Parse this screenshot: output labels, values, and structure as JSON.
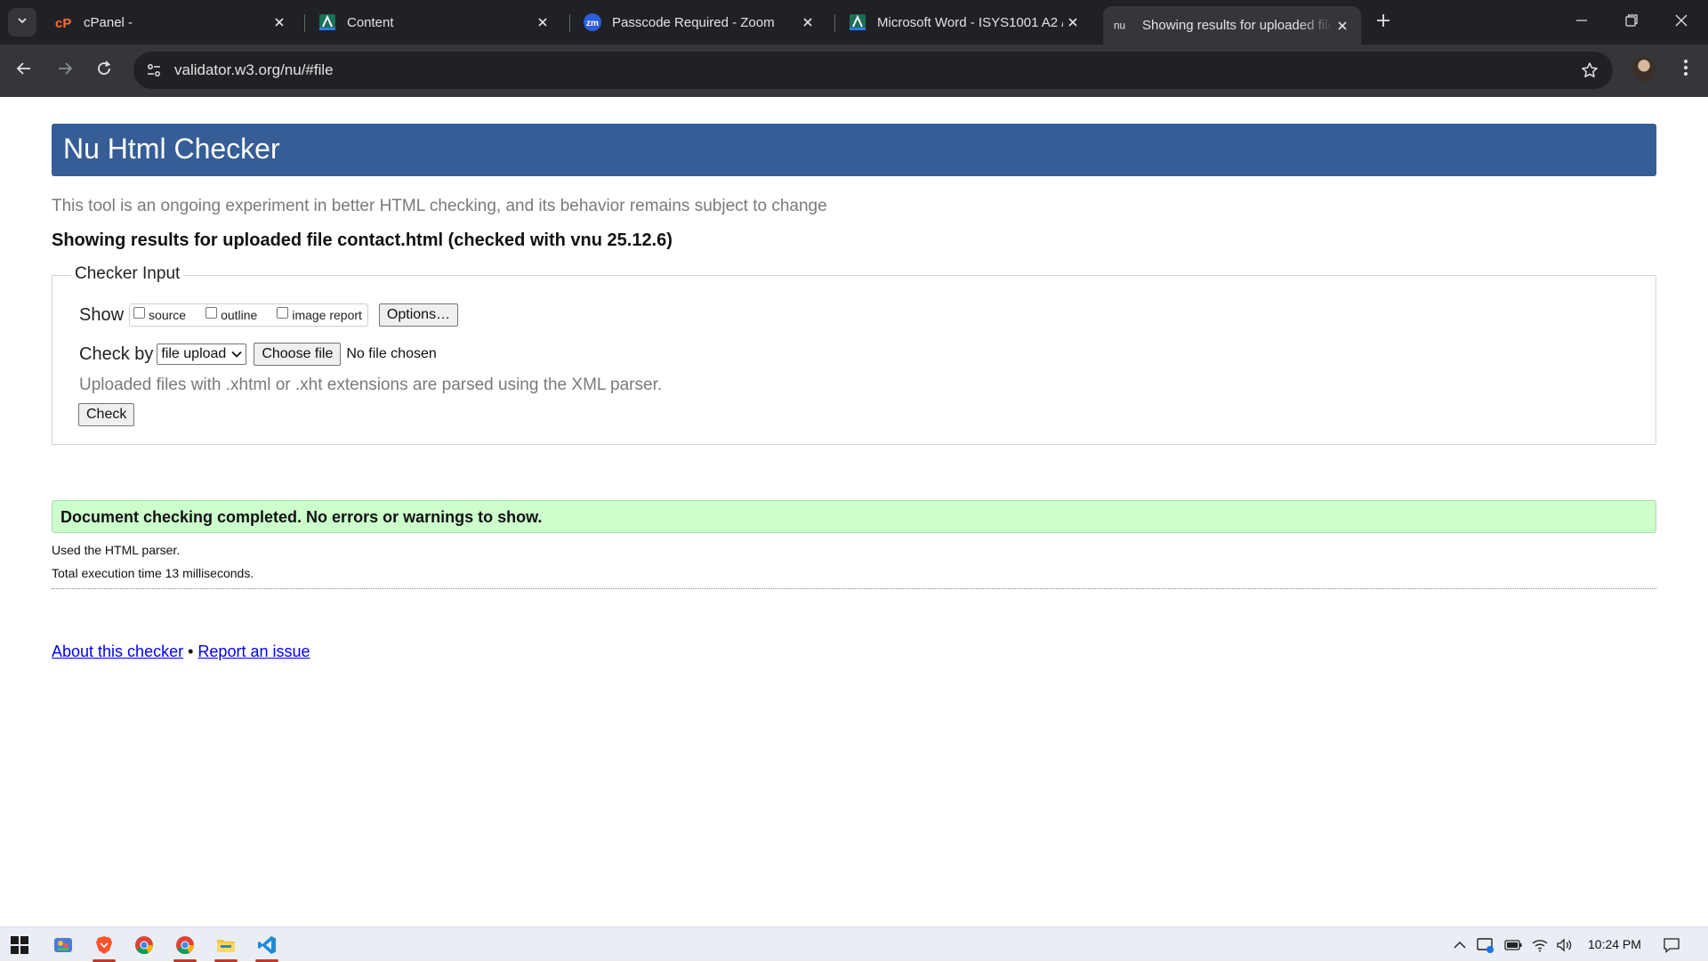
{
  "browser": {
    "tabs": [
      {
        "title": "cPanel -",
        "favicon": "cpanel-icon",
        "active": false
      },
      {
        "title": "Content",
        "favicon": "a-logo-icon",
        "active": false
      },
      {
        "title": "Passcode Required - Zoom",
        "favicon": "zoom-icon",
        "active": false
      },
      {
        "title": "Microsoft Word - ISYS1001 A2 /",
        "favicon": "a-logo-icon",
        "active": false
      },
      {
        "title": "Showing results for uploaded file",
        "favicon": "nu-icon",
        "active": true
      }
    ],
    "url": "validator.w3.org/nu/#file"
  },
  "page": {
    "banner_title": "Nu Html Checker",
    "intro": "This tool is an ongoing experiment in better HTML checking, and its behavior remains subject to change",
    "results_heading": "Showing results for uploaded file contact.html (checked with vnu 25.12.6)",
    "checker_input": {
      "legend": "Checker Input",
      "show_label": "Show",
      "checkboxes": [
        "source",
        "outline",
        "image report"
      ],
      "options_button": "Options…",
      "check_by_label": "Check by",
      "check_by_selected": "file upload",
      "choose_file_button": "Choose file",
      "no_file_text": "No file chosen",
      "note": "Uploaded files with .xhtml or .xht extensions are parsed using the XML parser.",
      "check_button": "Check"
    },
    "success_message": "Document checking completed. No errors or warnings to show.",
    "parser_info": "Used the HTML parser.",
    "execution_time": "Total execution time 13 milliseconds.",
    "footer": {
      "about_link": "About this checker",
      "separator": "•",
      "report_link": "Report an issue"
    }
  },
  "taskbar": {
    "clock": "10:24 PM",
    "apps": [
      "windows-start-icon",
      "task-manager-icon",
      "brave-icon",
      "chrome-icon",
      "chrome-icon",
      "file-explorer-icon",
      "vscode-icon"
    ]
  },
  "colors": {
    "banner": "#365d95",
    "success_bg": "#ccffcc",
    "link": "#0000ee",
    "chrome_dark": "#202124"
  }
}
